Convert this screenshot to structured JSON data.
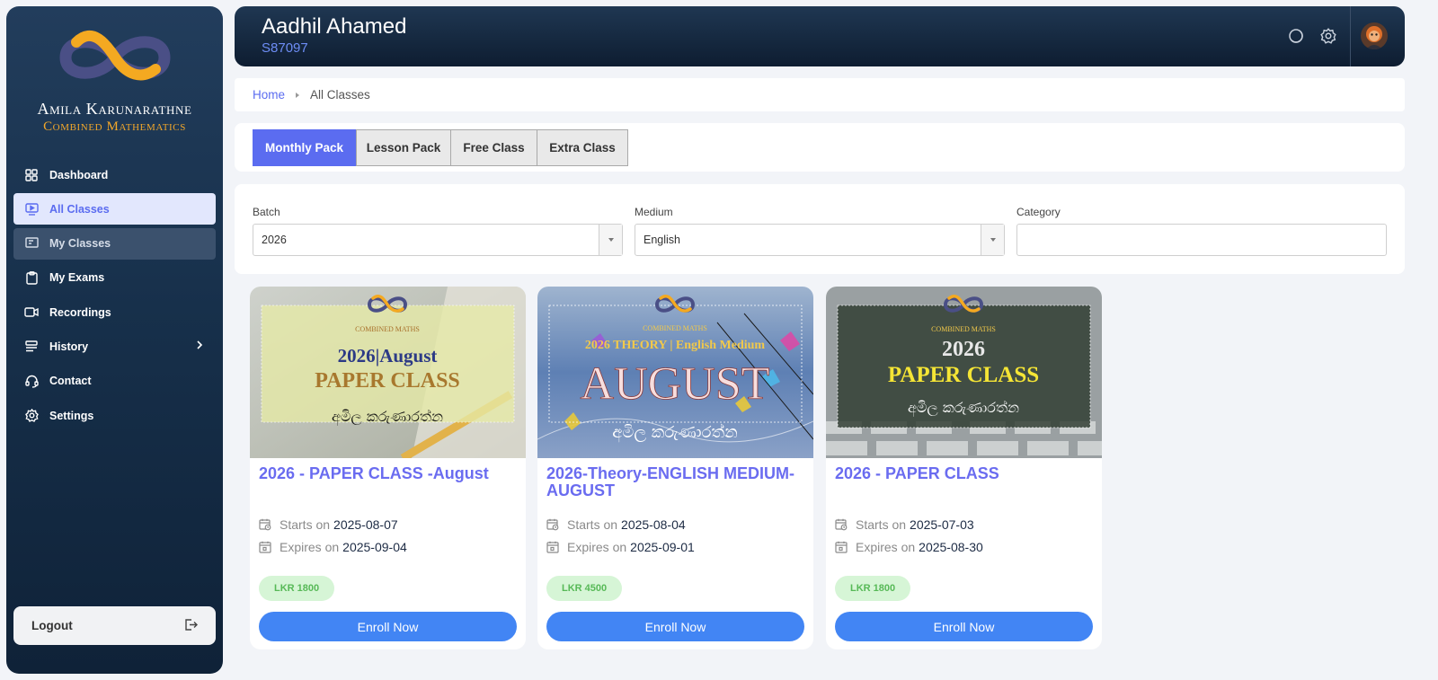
{
  "brand": {
    "name": "Amila Karunarathne",
    "subtitle": "Combined Mathematics"
  },
  "sidebar": {
    "items": [
      {
        "label": "Dashboard"
      },
      {
        "label": "All Classes"
      },
      {
        "label": "My Classes"
      },
      {
        "label": "My Exams"
      },
      {
        "label": "Recordings"
      },
      {
        "label": "History"
      },
      {
        "label": "Contact"
      },
      {
        "label": "Settings"
      }
    ],
    "logout_label": "Logout"
  },
  "header": {
    "user_name": "Aadhil Ahamed",
    "user_id": "S87097"
  },
  "breadcrumb": {
    "home": "Home",
    "current": "All Classes"
  },
  "tabs": [
    {
      "label": "Monthly Pack"
    },
    {
      "label": "Lesson Pack"
    },
    {
      "label": "Free Class"
    },
    {
      "label": "Extra Class"
    }
  ],
  "filters": {
    "batch": {
      "label": "Batch",
      "value": "2026"
    },
    "medium": {
      "label": "Medium",
      "value": "English"
    },
    "category": {
      "label": "Category",
      "value": ""
    }
  },
  "cards": [
    {
      "title": "2026 - PAPER CLASS -August",
      "starts_label": "Starts on",
      "starts": "2025-08-07",
      "expires_label": "Expires on",
      "expires": "2025-09-04",
      "price": "LKR 1800",
      "enroll_label": "Enroll Now",
      "banner": {
        "top": "COMBINED MATHS",
        "line1": "2026|August",
        "line2": "PAPER CLASS",
        "sinhala": "අමිල කරුණාරත්න"
      }
    },
    {
      "title": "2026-Theory-ENGLISH MEDIUM-AUGUST",
      "starts_label": "Starts on",
      "starts": "2025-08-04",
      "expires_label": "Expires on",
      "expires": "2025-09-01",
      "price": "LKR 4500",
      "enroll_label": "Enroll Now",
      "banner": {
        "top": "COMBINED MATHS",
        "line1": "2026 THEORY | English Medium",
        "line2": "AUGUST",
        "sinhala": "අමිල කරුණාරත්න"
      }
    },
    {
      "title": "2026 - PAPER CLASS",
      "starts_label": "Starts on",
      "starts": "2025-07-03",
      "expires_label": "Expires on",
      "expires": "2025-08-30",
      "price": "LKR 1800",
      "enroll_label": "Enroll Now",
      "banner": {
        "top": "COMBINED MATHS",
        "line1": "2026",
        "line2": "PAPER CLASS",
        "sinhala": "අමිල කරුණාරත්න"
      }
    }
  ],
  "colors": {
    "accent": "#5b6cf0",
    "enroll": "#4285f4",
    "brand_orange": "#f2a72a",
    "price_bg": "#d6f5d6",
    "price_text": "#57b957"
  }
}
